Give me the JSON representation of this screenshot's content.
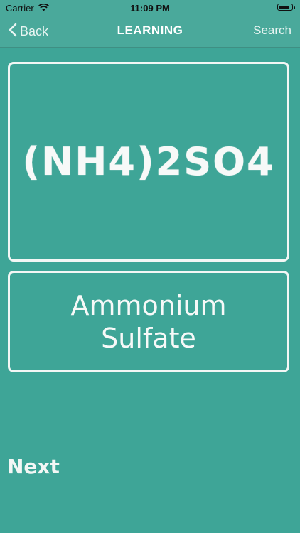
{
  "status_bar": {
    "carrier": "Carrier",
    "time": "11:09 PM"
  },
  "nav": {
    "back_label": "Back",
    "title": "LEARNING",
    "search_label": "Search"
  },
  "card": {
    "formula": "(NH4)2SO4",
    "name_line1": "Ammonium",
    "name_line2": "Sulfate"
  },
  "next_label": "Next",
  "colors": {
    "background": "#3ea597",
    "bar": "#4aa99b",
    "chalk": "#f3f7f5"
  }
}
